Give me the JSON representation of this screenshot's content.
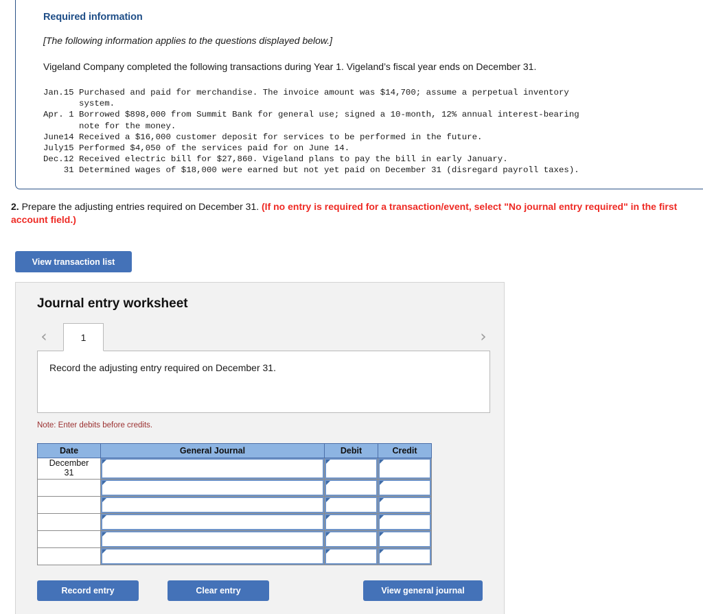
{
  "required_information": {
    "title": "Required information",
    "applies_note": "[The following information applies to the questions displayed below.]",
    "intro": "Vigeland Company completed the following transactions during Year 1. Vigeland’s fiscal year ends on December 31.",
    "transactions_text": "Jan.15 Purchased and paid for merchandise. The invoice amount was $14,700; assume a perpetual inventory\n       system.\nApr. 1 Borrowed $898,000 from Summit Bank for general use; signed a 10-month, 12% annual interest-bearing\n       note for the money.\nJune14 Received a $16,000 customer deposit for services to be performed in the future.\nJuly15 Performed $4,050 of the services paid for on June 14.\nDec.12 Received electric bill for $27,860. Vigeland plans to pay the bill in early January.\n    31 Determined wages of $18,000 were earned but not yet paid on December 31 (disregard payroll taxes).",
    "transactions": [
      {
        "date": "Jan.15",
        "text": "Purchased and paid for merchandise. The invoice amount was $14,700; assume a perpetual inventory system."
      },
      {
        "date": "Apr. 1",
        "text": "Borrowed $898,000 from Summit Bank for general use; signed a 10-month, 12% annual interest-bearing note for the money."
      },
      {
        "date": "June14",
        "text": "Received a $16,000 customer deposit for services to be performed in the future."
      },
      {
        "date": "July15",
        "text": "Performed $4,050 of the services paid for on June 14."
      },
      {
        "date": "Dec.12",
        "text": "Received electric bill for $27,860. Vigeland plans to pay the bill in early January."
      },
      {
        "date": "    31",
        "text": "Determined wages of $18,000 were earned but not yet paid on December 31 (disregard payroll taxes)."
      }
    ]
  },
  "question": {
    "number": "2.",
    "text": " Prepare the adjusting entries required on December 31. ",
    "red_text": "(If no entry is required for a transaction/event, select \"No journal entry required\" in the first account field.)"
  },
  "buttons": {
    "view_transaction_list": "View transaction list",
    "record_entry": "Record entry",
    "clear_entry": "Clear entry",
    "view_general_journal": "View general journal"
  },
  "worksheet": {
    "title": "Journal entry worksheet",
    "tabs": [
      "1"
    ],
    "active_tab": "1",
    "prev_icon": "‹",
    "next_icon": "›",
    "instruction": "Record the adjusting entry required on December 31.",
    "note": "Note: Enter debits before credits.",
    "table": {
      "headers": [
        "Date",
        "General Journal",
        "Debit",
        "Credit"
      ],
      "rows": [
        {
          "date": "December\n31",
          "general_journal": "",
          "debit": "",
          "credit": ""
        },
        {
          "date": "",
          "general_journal": "",
          "debit": "",
          "credit": ""
        },
        {
          "date": "",
          "general_journal": "",
          "debit": "",
          "credit": ""
        },
        {
          "date": "",
          "general_journal": "",
          "debit": "",
          "credit": ""
        },
        {
          "date": "",
          "general_journal": "",
          "debit": "",
          "credit": ""
        },
        {
          "date": "",
          "general_journal": "",
          "debit": "",
          "credit": ""
        }
      ]
    }
  },
  "colors": {
    "panel_border": "#2b5288",
    "heading_blue": "#1f4e87",
    "button_blue": "#4472b8",
    "table_header_blue": "#8db4e2",
    "alert_red": "#ee2a24",
    "note_red": "#9b3030"
  }
}
